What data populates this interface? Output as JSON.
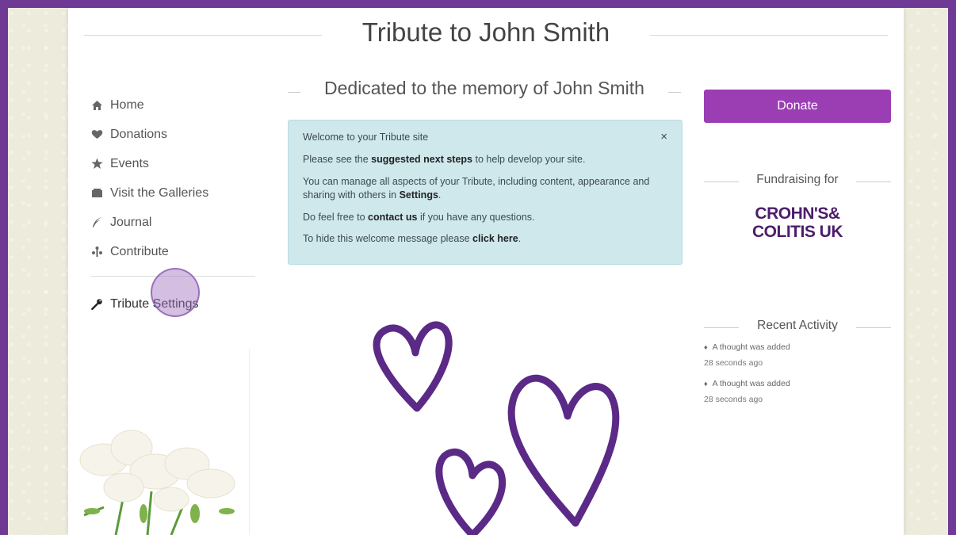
{
  "site": {
    "title": "Tribute to John Smith"
  },
  "nav": {
    "items": [
      {
        "label": "Home",
        "icon": "home-icon"
      },
      {
        "label": "Donations",
        "icon": "heart-icon"
      },
      {
        "label": "Events",
        "icon": "star-icon"
      },
      {
        "label": "Visit the Galleries",
        "icon": "gallery-icon"
      },
      {
        "label": "Journal",
        "icon": "quill-icon"
      },
      {
        "label": "Contribute",
        "icon": "contribute-icon"
      }
    ],
    "settings": {
      "label": "Tribute Settings",
      "icon": "wrench-icon"
    }
  },
  "main": {
    "dedication": "Dedicated to the memory of John Smith",
    "welcome": {
      "close": "×",
      "line1": "Welcome to your Tribute site",
      "line2_pre": "Please see the ",
      "line2_bold": "suggested next steps",
      "line2_post": " to help develop your site.",
      "line3_pre": "You can manage all aspects of your Tribute, including content, appearance and sharing with others in ",
      "line3_bold": "Settings",
      "line3_post": ".",
      "line4_pre": "Do feel free to ",
      "line4_bold": "contact us",
      "line4_post": " if you have any questions.",
      "line5_pre": "To hide this welcome message please ",
      "line5_bold": "click here",
      "line5_post": "."
    }
  },
  "right": {
    "donate_label": "Donate",
    "fundraising_heading": "Fundraising for",
    "charity_line1": "CROHN'S&",
    "charity_line2": "COLITIS UK",
    "activity_heading": "Recent Activity",
    "activity": [
      {
        "text": "A thought was added",
        "time": "28 seconds ago"
      },
      {
        "text": "A thought was added",
        "time": "28 seconds ago"
      }
    ]
  },
  "colors": {
    "accent": "#9b3eb4",
    "frame": "#6e3a96",
    "welcome_bg": "#cfe8ec",
    "heart": "#5a2a86"
  }
}
